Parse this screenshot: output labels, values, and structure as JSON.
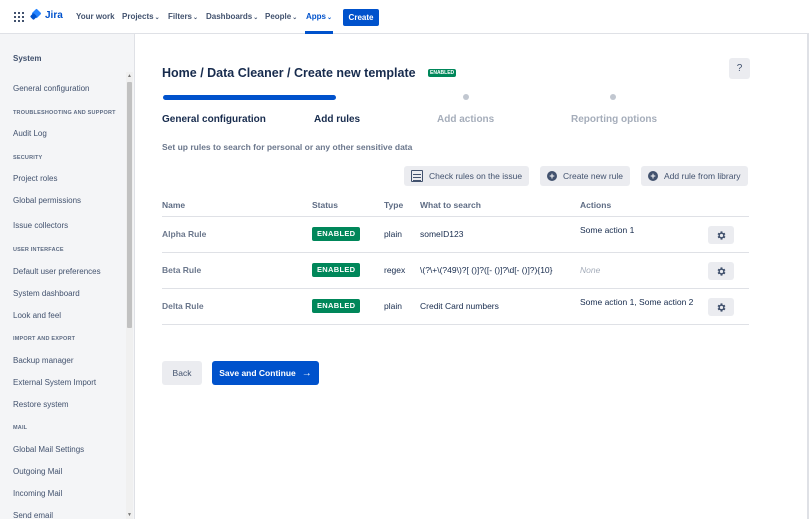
{
  "topnav": {
    "logo": "Jira",
    "items": [
      {
        "label": "Your work",
        "chevron": false
      },
      {
        "label": "Projects",
        "chevron": true
      },
      {
        "label": "Filters",
        "chevron": true
      },
      {
        "label": "Dashboards",
        "chevron": true
      },
      {
        "label": "People",
        "chevron": true
      },
      {
        "label": "Apps",
        "chevron": true,
        "active": true
      }
    ],
    "create_label": "Create",
    "chevron_glyph": "⌄"
  },
  "sidebar": {
    "title": "System",
    "sections": [
      {
        "items": [
          "General configuration"
        ]
      },
      {
        "heading": "TROUBLESHOOTING AND SUPPORT",
        "items": [
          "Audit Log"
        ]
      },
      {
        "heading": "SECURITY",
        "items": [
          "Project roles",
          "Global permissions",
          "Issue collectors"
        ]
      },
      {
        "heading": "USER INTERFACE",
        "items": [
          "Default user preferences",
          "System dashboard",
          "Look and feel"
        ]
      },
      {
        "heading": "IMPORT AND EXPORT",
        "items": [
          "Backup manager",
          "External System Import",
          "Restore system"
        ]
      },
      {
        "heading": "MAIL",
        "items": [
          "Global Mail Settings",
          "Outgoing Mail",
          "Incoming Mail",
          "Send email"
        ]
      }
    ]
  },
  "header": {
    "title": "Home / Data Cleaner / Create new template",
    "status": "ENABLED",
    "help": "?"
  },
  "wizard": {
    "progress": 0.25,
    "steps": [
      {
        "label": "General configuration",
        "state": "active"
      },
      {
        "label": "Add rules",
        "state": "active"
      },
      {
        "label": "Add actions",
        "state": "inactive"
      },
      {
        "label": "Reporting options",
        "state": "inactive"
      }
    ],
    "subtitle": "Set up rules to search for personal or any other sensitive data"
  },
  "toolbar": {
    "check_label": "Check rules on the issue",
    "create_label": "Create new rule",
    "library_label": "Add rule from library"
  },
  "table": {
    "headers": {
      "name": "Name",
      "status": "Status",
      "type": "Type",
      "what": "What to search",
      "actions": "Actions"
    },
    "rows": [
      {
        "name": "Alpha Rule",
        "status": "ENABLED",
        "type": "plain",
        "what": "someID123",
        "actions": "Some action 1",
        "none": false
      },
      {
        "name": "Beta Rule",
        "status": "ENABLED",
        "type": "regex",
        "what": "\\(?\\+\\(?49\\)?[ ()]?([- ()]?\\d[- ()]?){10}",
        "actions": "None",
        "none": true
      },
      {
        "name": "Delta Rule",
        "status": "ENABLED",
        "type": "plain",
        "what": "Credit Card numbers",
        "actions": "Some action 1, Some action 2",
        "none": false
      }
    ]
  },
  "footer": {
    "back_label": "Back",
    "save_label": "Save and Continue"
  },
  "colors": {
    "primary": "#0052cc",
    "success": "#00875a",
    "neutral_bg": "#ebecf0",
    "sidebar_bg": "#f4f5f7"
  }
}
